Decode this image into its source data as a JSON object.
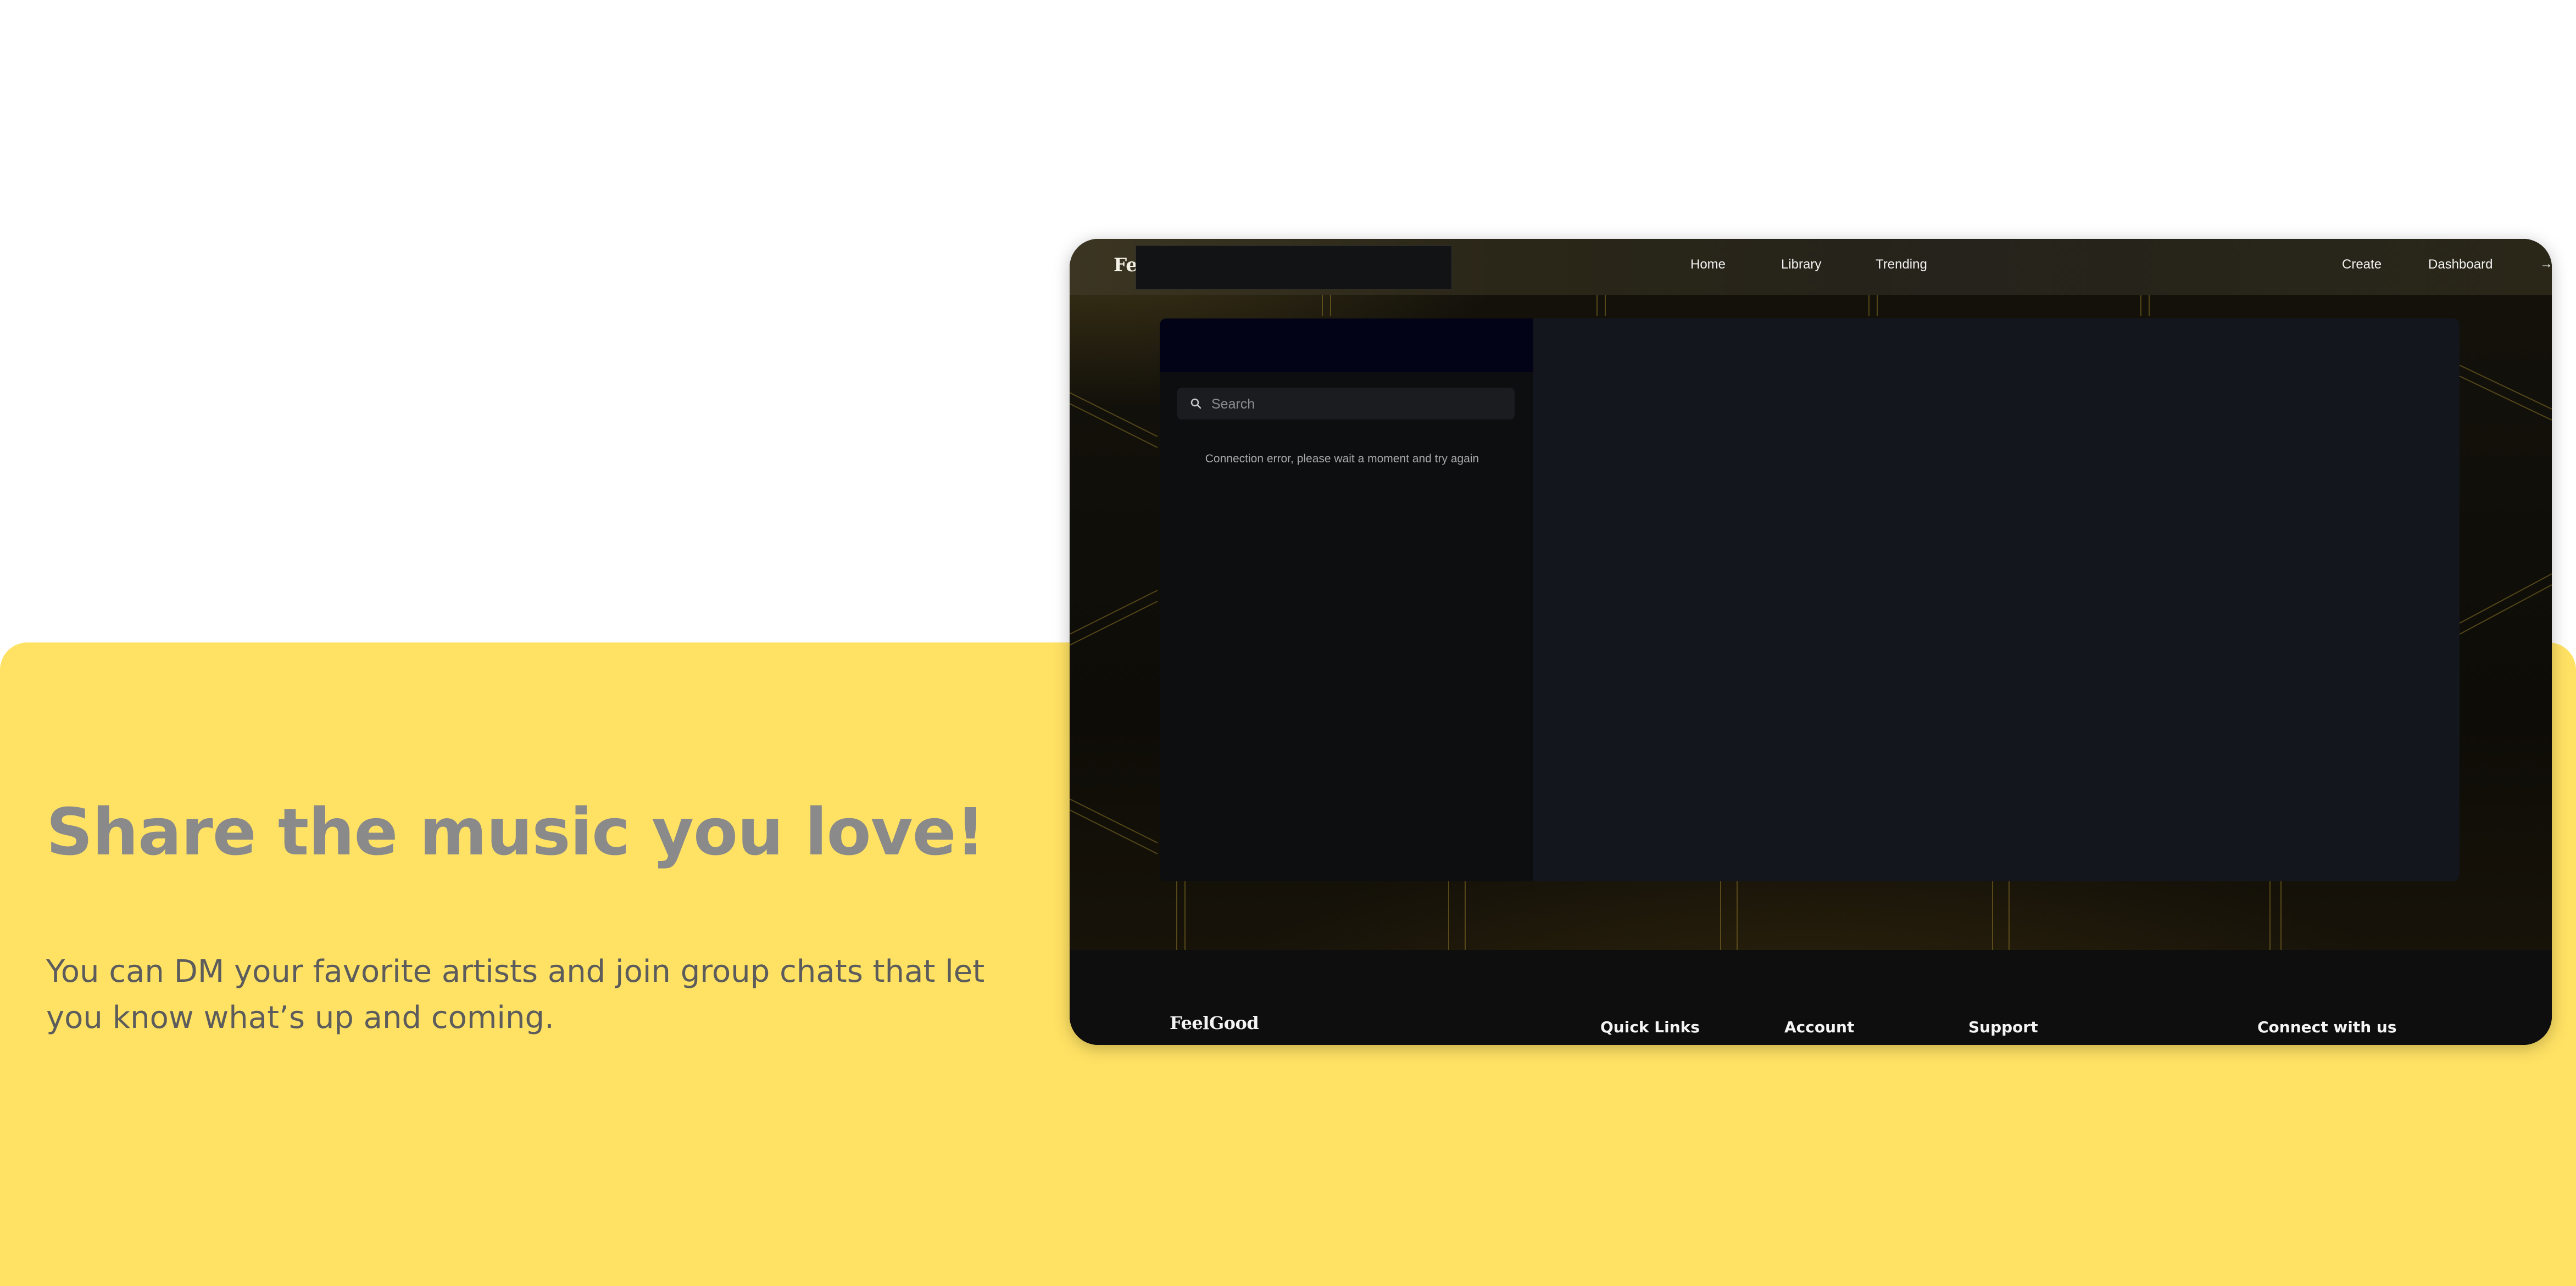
{
  "promo": {
    "title": "Share the music you love!",
    "description": "You can DM your favorite artists and join group chats that let you know what’s up and coming."
  },
  "app": {
    "nav": {
      "logo": "Fe",
      "links": [
        "Home",
        "Library",
        "Trending"
      ],
      "right_links": [
        "Create",
        "Dashboard"
      ],
      "more": "→"
    },
    "chat": {
      "search_placeholder": "Search",
      "error": "Connection error, please wait a moment and try again"
    },
    "footer": {
      "logo": "FeelGood",
      "headings": [
        "Quick Links",
        "Account",
        "Support",
        "Connect with us"
      ]
    }
  },
  "colors": {
    "promo_band": "#ffe264",
    "promo_title": "#8a8a8a",
    "promo_text": "#5c5c5c",
    "app_background": "#0b0a07",
    "chat_sidebar": "#0d0e10",
    "chat_main": "#13161c",
    "accent_lines": "#8a7426"
  }
}
